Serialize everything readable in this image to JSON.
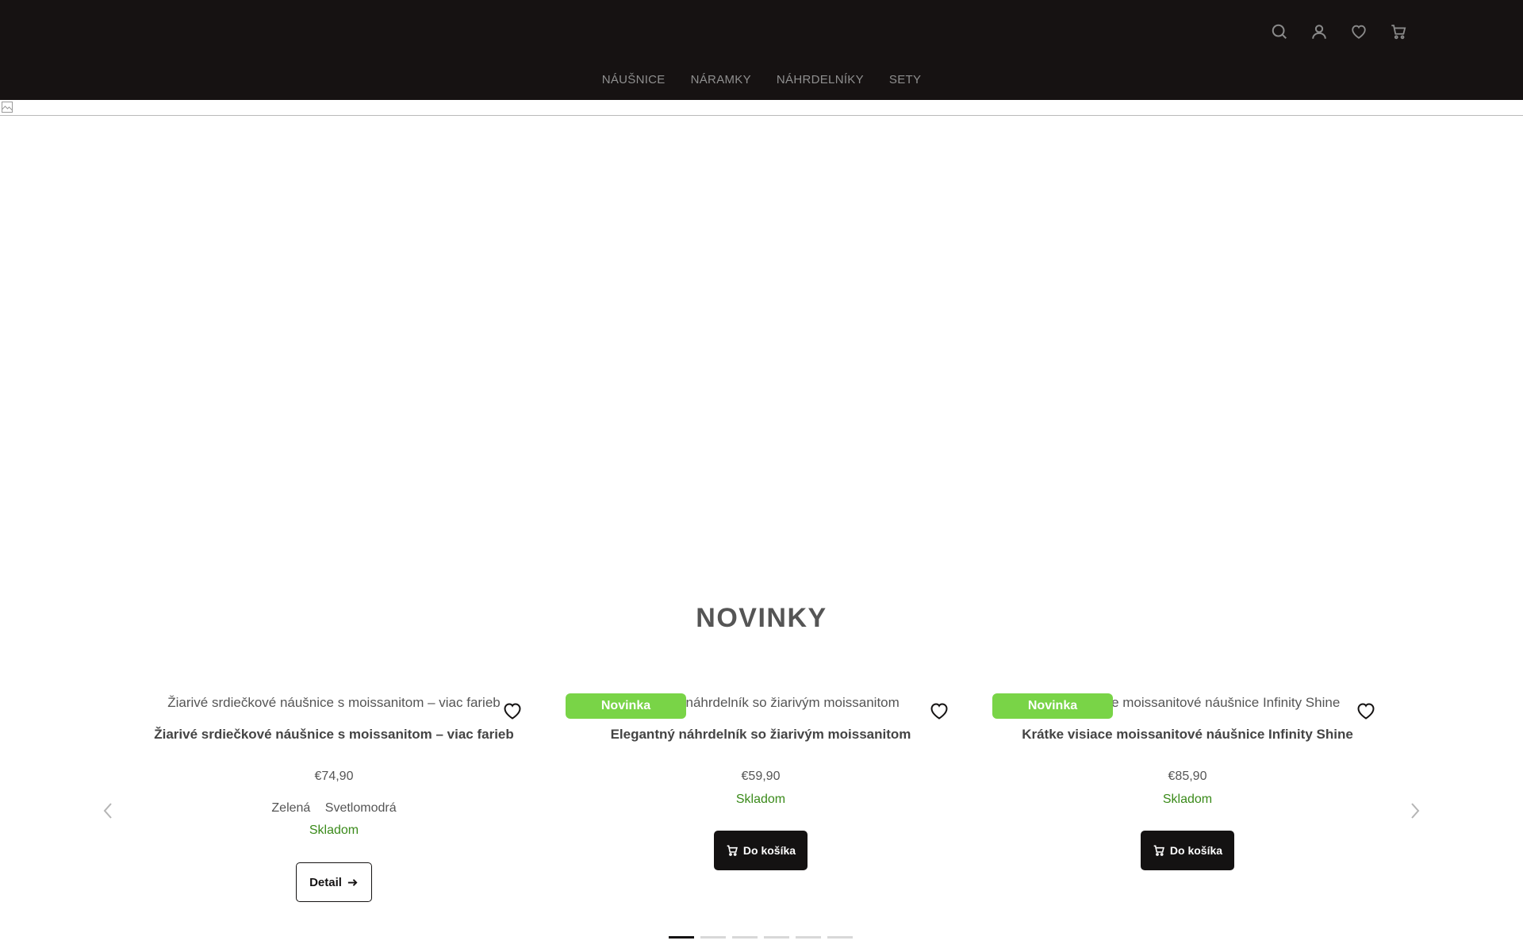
{
  "header": {
    "icons": [
      "search-icon",
      "user-icon",
      "heart-icon",
      "cart-icon"
    ],
    "nav": [
      "NÁUŠNICE",
      "NÁRAMKY",
      "NÁHRDELNÍKY",
      "SETY"
    ]
  },
  "section": {
    "title": "NOVINKY"
  },
  "products": [
    {
      "image_alt": "Žiarivé srdiečkové náušnice s moissanitom – viac farieb",
      "title": "Žiarivé srdiečkové náušnice s moissanitom – viac farieb",
      "price": "€74,90",
      "variants": [
        "Zelená",
        "Svetlomodrá"
      ],
      "stock": "Skladom",
      "button": "Detail"
    },
    {
      "badge": "Novinka",
      "image_alt": "Elegantný náhrdelník so žiarivým moissanitom",
      "title": "Elegantný náhrdelník so žiarivým moissanitom",
      "price": "€59,90",
      "stock": "Skladom",
      "button": "Do košíka"
    },
    {
      "badge": "Novinka",
      "image_alt": "Krátke visiace moissanitové náušnice Infinity Shine",
      "title": "Krátke visiace moissanitové náušnice Infinity Shine",
      "price": "€85,90",
      "stock": "Skladom",
      "button": "Do košíka"
    }
  ],
  "carousel": {
    "dot_count": 6,
    "active_dot": 1
  },
  "colors": {
    "header_bg": "#161212",
    "badge": "#79d447",
    "stock": "#3a8a1a",
    "button_dark": "#141212"
  }
}
